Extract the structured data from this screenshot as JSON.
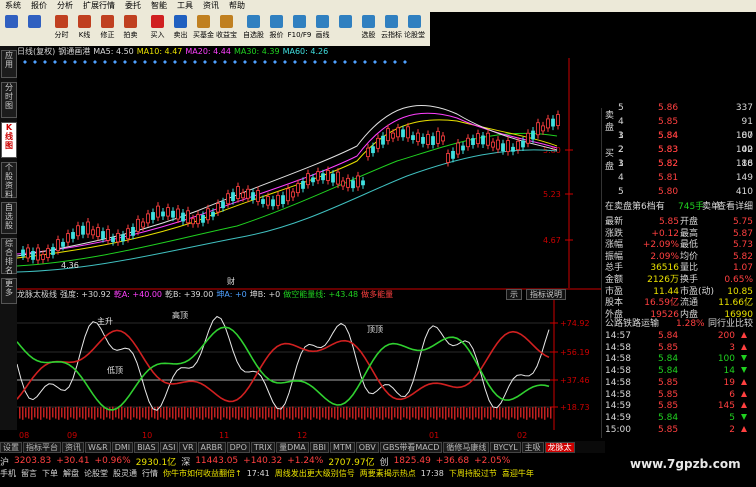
{
  "menu": [
    "系统",
    "报价",
    "分析",
    "扩展行情",
    "委托",
    "智能",
    "工具",
    "资讯",
    "帮助"
  ],
  "toolbar": [
    {
      "label": "",
      "icon": "back-icon",
      "color": "#3060c0"
    },
    {
      "label": "",
      "icon": "forward-icon",
      "color": "#3060c0"
    },
    {
      "label": "分时",
      "icon": "timeshare-icon",
      "color": "#c04020"
    },
    {
      "label": "K线",
      "icon": "kline-icon",
      "color": "#c04020"
    },
    {
      "label": "修正",
      "icon": "correct-icon",
      "color": "#c04020"
    },
    {
      "label": "拍卖",
      "icon": "auction-icon",
      "color": "#c04020"
    },
    {
      "label": "买入",
      "icon": "buy-icon",
      "color": "#d02020"
    },
    {
      "label": "卖出",
      "icon": "sell-icon",
      "color": "#2060c0"
    },
    {
      "label": "买基金",
      "icon": "fund-icon",
      "color": "#c08020"
    },
    {
      "label": "收益宝",
      "icon": "treasure-icon",
      "color": "#c08020"
    },
    {
      "label": "自选股",
      "icon": "favorite-icon",
      "color": "#3080c0"
    },
    {
      "label": "报价",
      "icon": "quote-icon",
      "color": "#3080c0"
    },
    {
      "label": "F10/F9",
      "icon": "f10-icon",
      "color": "#3080c0"
    },
    {
      "label": "画线",
      "icon": "draw-icon",
      "color": "#3080c0"
    },
    {
      "label": "",
      "icon": "tool-icon",
      "color": "#3080c0"
    },
    {
      "label": "选股",
      "icon": "select-icon",
      "color": "#3080c0"
    },
    {
      "label": "云指标",
      "icon": "cloud-icon",
      "color": "#3080c0"
    },
    {
      "label": "论股堂",
      "icon": "forum-icon",
      "color": "#3080c0"
    }
  ],
  "sidetabs": [
    "应用",
    "分时图",
    "K线图",
    "个股资料",
    "自选股",
    "综合排名",
    "更多"
  ],
  "chart_title": {
    "period": "日线(复权)",
    "pattern": "钢通画港",
    "ma5": "MA5: 4.50",
    "ma10": "MA10: 4.47",
    "ma20": "MA20: 4.44",
    "ma30": "MA30: 4.39",
    "ma60": "MA60: 4.26"
  },
  "price_axis": [
    "5.80",
    "5.23",
    "4.67"
  ],
  "low_label": "4.36",
  "candle_marker": "财",
  "ind_title": {
    "name": "龙脉太极线",
    "strength": "强度: +30.92",
    "qianyuan": "乾A: +40.00",
    "qiankun": "乾B: +39.00",
    "kun": "坤A: +0",
    "kunb": "坤B: +0",
    "energy": "做空能量线: +43.48",
    "warn": "做多能量"
  },
  "ind_buttons": [
    "示",
    "指标说明"
  ],
  "ind_axis": [
    "74.92",
    "56.19",
    "37.46",
    "18.73"
  ],
  "ind_labels": [
    "主升",
    "高顶",
    "顶顶",
    "低顶"
  ],
  "x_axis": [
    "08",
    "09",
    "10",
    "11",
    "12",
    "01",
    "02"
  ],
  "tabs": [
    "设置",
    "指标平台",
    "资讯",
    "W&R",
    "DMI",
    "BIAS",
    "ASI",
    "VR",
    "ARBR",
    "DPO",
    "TRIX",
    "量DMA",
    "BBI",
    "MTM",
    "OBV",
    "GBS带看MACD",
    "循修马康线",
    "BYCYL",
    "主吸",
    "龙脉太"
  ],
  "status1": {
    "sh": "沪",
    "sh_val": "3203.83",
    "sh_chg": "+30.41",
    "sh_pct": "+0.96%",
    "sh_vol": "2930.1亿",
    "sz": "深",
    "sz_val": "11443.05",
    "sz_chg": "+140.32",
    "sz_pct": "+1.24%",
    "cy": "2707.97亿",
    "cy_lbl": "创",
    "cy_val": "1825.49",
    "cy_chg": "+36.68",
    "cy_pct": "+2.05%"
  },
  "status2": {
    "items": [
      "手机",
      "留言",
      "下单",
      "解盘",
      "论股堂",
      "股灵通",
      "行情"
    ],
    "news1": "你牛市如何收益翻倍↑",
    "time1": "17:41",
    "news2": "周线发出更大级别信号",
    "news3": "两要素揭示热点",
    "time2": "17:38",
    "news4": "下周持股过节",
    "news5": "喜迎牛年"
  },
  "order_book": {
    "sell": [
      {
        "lvl": "5",
        "price": "5.86",
        "vol": "337"
      },
      {
        "lvl": "4",
        "price": "5.85",
        "vol": "91"
      },
      {
        "lvl": "3",
        "price": "5.84",
        "vol": "87"
      },
      {
        "lvl": "2",
        "price": "5.83",
        "vol": "40"
      },
      {
        "lvl": "1",
        "price": "5.82",
        "vol": "18"
      }
    ],
    "buy": [
      {
        "lvl": "1",
        "price": "5.84",
        "vol": "100"
      },
      {
        "lvl": "2",
        "price": "5.83",
        "vol": "102"
      },
      {
        "lvl": "3",
        "price": "5.82",
        "vol": "186"
      },
      {
        "lvl": "4",
        "price": "5.81",
        "vol": "149"
      },
      {
        "lvl": "5",
        "price": "5.80",
        "vol": "410"
      }
    ],
    "sell_label": "卖盘",
    "buy_label": "买盘"
  },
  "queue": {
    "label": "在卖盘第6档有",
    "count": "745手",
    "sell": "卖单",
    "detail": "查看详细"
  },
  "stats": [
    {
      "k1": "最新",
      "v1": "5.85",
      "k2": "开盘",
      "v2": "5.75"
    },
    {
      "k1": "涨跌",
      "v1": "+0.12",
      "k2": "最高",
      "v2": "5.87"
    },
    {
      "k1": "涨幅",
      "v1": "+2.09%",
      "k2": "最低",
      "v2": "5.73"
    },
    {
      "k1": "振幅",
      "v1": "2.09%",
      "k2": "均价",
      "v2": "5.82"
    },
    {
      "k1": "总手",
      "v1": "36516",
      "k2": "量比",
      "v2": "1.07"
    },
    {
      "k1": "金额",
      "v1": "2126万",
      "k2": "换手",
      "v2": "0.65%"
    },
    {
      "k1": "市盈",
      "v1": "11.44",
      "k2": "市盈(动)",
      "v2": "10.85"
    },
    {
      "k1": "股本",
      "v1": "16.59亿",
      "k2": "流通",
      "v2": "11.66亿"
    },
    {
      "k1": "外盘",
      "v1": "19526",
      "k2": "内盘",
      "v2": "16990"
    }
  ],
  "sector": {
    "name": "公路铁路运输",
    "pct": "1.28%",
    "compare": "同行业比较"
  },
  "ticks": [
    {
      "t": "14:57",
      "p": "5.84",
      "v": "200",
      "d": "up"
    },
    {
      "t": "14:58",
      "p": "5.85",
      "v": "3",
      "d": "up"
    },
    {
      "t": "14:58",
      "p": "5.84",
      "v": "100",
      "d": "down"
    },
    {
      "t": "14:58",
      "p": "5.84",
      "v": "14",
      "d": "down"
    },
    {
      "t": "14:58",
      "p": "5.85",
      "v": "19",
      "d": "up"
    },
    {
      "t": "14:58",
      "p": "5.85",
      "v": "6",
      "d": "up"
    },
    {
      "t": "14:59",
      "p": "5.85",
      "v": "145",
      "d": "up"
    },
    {
      "t": "14:59",
      "p": "5.84",
      "v": "5",
      "d": "down"
    },
    {
      "t": "15:00",
      "p": "5.85",
      "v": "2",
      "d": "up"
    }
  ],
  "watermark": "www.7gpzb.com"
}
